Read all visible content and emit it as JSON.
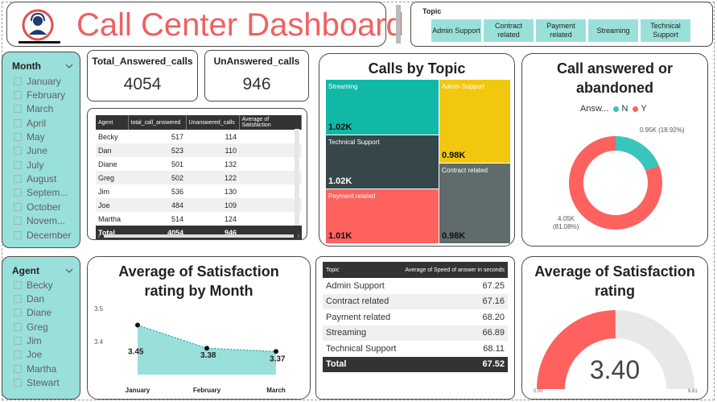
{
  "header": {
    "title": "Call Center Dashboard",
    "topic_slicer": {
      "label": "Topic",
      "options": [
        "Admin Support",
        "Contract related",
        "Payment related",
        "Streaming",
        "Technical Support"
      ]
    }
  },
  "month_slicer": {
    "title": "Month",
    "items": [
      "January",
      "February",
      "March",
      "April",
      "May",
      "June",
      "July",
      "August",
      "Septem...",
      "October",
      "Novem...",
      "December"
    ]
  },
  "agent_slicer": {
    "title": "Agent",
    "items": [
      "Becky",
      "Dan",
      "Diane",
      "Greg",
      "Jim",
      "Joe",
      "Martha",
      "Stewart"
    ]
  },
  "kpis": {
    "answered": {
      "label": "Total_Answered_calls",
      "value": "4054"
    },
    "unanswered": {
      "label": "UnAnswered_calls",
      "value": "946"
    }
  },
  "agent_table": {
    "columns": [
      "Agent",
      "total_call_answered",
      "Unanswered_calls",
      "Average of Satisfaction"
    ],
    "rows": [
      {
        "agent": "Becky",
        "answered": "517",
        "unanswered": "114"
      },
      {
        "agent": "Dan",
        "answered": "523",
        "unanswered": "110"
      },
      {
        "agent": "Diane",
        "answered": "501",
        "unanswered": "132"
      },
      {
        "agent": "Greg",
        "answered": "502",
        "unanswered": "122"
      },
      {
        "agent": "Jim",
        "answered": "536",
        "unanswered": "130"
      },
      {
        "agent": "Joe",
        "answered": "484",
        "unanswered": "109"
      },
      {
        "agent": "Martha",
        "answered": "514",
        "unanswered": "124"
      }
    ],
    "total": {
      "label": "Total",
      "answered": "4054",
      "unanswered": "946"
    }
  },
  "treemap": {
    "title": "Calls by Topic",
    "tiles": [
      {
        "name": "Streaming",
        "value": "1.02K",
        "color": "#11b8a8"
      },
      {
        "name": "Admin Support",
        "value": "0.98K",
        "color": "#f2c80f"
      },
      {
        "name": "Technical Support",
        "value": "1.02K",
        "color": "#374649"
      },
      {
        "name": "Contract related",
        "value": "0.98K",
        "color": "#5f6b6d"
      },
      {
        "name": "Payment related",
        "value": "1.01K",
        "color": "#fd625e"
      }
    ]
  },
  "donut": {
    "title_line1": "Call answered or",
    "title_line2": "abandoned",
    "legend_title": "Answ...",
    "legend": [
      {
        "label": "N",
        "color": "#39c5bb"
      },
      {
        "label": "Y",
        "color": "#fd625e"
      }
    ],
    "label_n": "0.95K (18.92%)",
    "label_y_1": "4.05K",
    "label_y_2": "(81.08%)"
  },
  "line_chart": {
    "title_line1": "Average of Satisfaction",
    "title_line2": "rating by Month",
    "y_ticks": [
      "3.5",
      "3.4"
    ],
    "labels": [
      "3.45",
      "3.38",
      "3.37"
    ]
  },
  "speed_table": {
    "columns": [
      "Topic",
      "Average of Speed of answer in seconds"
    ],
    "rows": [
      {
        "topic": "Admin Support",
        "value": "67.25"
      },
      {
        "topic": "Contract related",
        "value": "67.16"
      },
      {
        "topic": "Payment related",
        "value": "68.20"
      },
      {
        "topic": "Streaming",
        "value": "66.89"
      },
      {
        "topic": "Technical Support",
        "value": "68.11"
      }
    ],
    "total": {
      "label": "Total",
      "value": "67.52"
    }
  },
  "gauge": {
    "title_line1": "Average of Satisfaction",
    "title_line2": "rating",
    "value": "3.40",
    "min": "0.00",
    "max": "6.81"
  },
  "chart_data": [
    {
      "type": "line",
      "title": "Average of Satisfaction rating by Month",
      "categories": [
        "January",
        "February",
        "March"
      ],
      "values": [
        3.45,
        3.38,
        3.37
      ],
      "ylim": [
        3.3,
        3.5
      ],
      "color": "#99e0da"
    },
    {
      "type": "pie",
      "title": "Call answered or abandoned",
      "categories": [
        "N",
        "Y"
      ],
      "values": [
        946,
        4054
      ],
      "colors": [
        "#39c5bb",
        "#fd625e"
      ]
    },
    {
      "type": "bar",
      "title": "Calls by Topic",
      "categories": [
        "Streaming",
        "Technical Support",
        "Payment related",
        "Admin Support",
        "Contract related"
      ],
      "values": [
        1020,
        1020,
        1010,
        980,
        980
      ]
    }
  ]
}
